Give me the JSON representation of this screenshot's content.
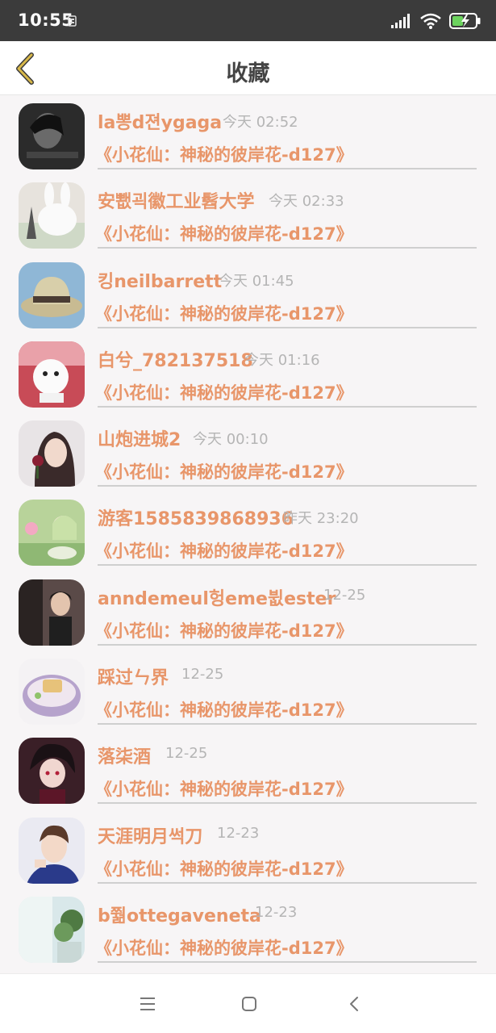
{
  "status_bar": {
    "time": "10:55",
    "icons": [
      "notification-icon",
      "signal-icon",
      "wifi-icon",
      "battery-charging-icon"
    ]
  },
  "header": {
    "title": "收藏",
    "back_icon": "chevron-left-icon"
  },
  "favorites": [
    {
      "name": "la뽕d젼ygaga",
      "time": "今天 02:52",
      "book": "《小花仙：神秘的彼岸花-d127》"
    },
    {
      "name": "安뾊괵徽工业髫大学",
      "time": "今天 02:33",
      "book": "《小花仙：神秘的彼岸花-d127》"
    },
    {
      "name": "킹neilbarrett",
      "time": "今天 01:45",
      "book": "《小花仙：神秘的彼岸花-d127》"
    },
    {
      "name": "白兮_782137518",
      "time": "今天 01:16",
      "book": "《小花仙：神秘的彼岸花-d127》"
    },
    {
      "name": "山炮进城2",
      "time": "今天 00:10",
      "book": "《小花仙：神秘的彼岸花-d127》"
    },
    {
      "name": "游客1585839868936",
      "time": "昨天 23:20",
      "book": "《小花仙：神秘的彼岸花-d127》"
    },
    {
      "name": "anndemeul헝eme뷦ester",
      "time": "12-25",
      "book": "《小花仙：神秘的彼岸花-d127》"
    },
    {
      "name": "踩过ㄣ界",
      "time": "12-25",
      "book": "《小花仙：神秘的彼岸花-d127》"
    },
    {
      "name": "落柒酒",
      "time": "12-25",
      "book": "《小花仙：神秘的彼岸花-d127》"
    },
    {
      "name": "天涯明月썩刀",
      "time": "12-23",
      "book": "《小花仙：神秘的彼岸花-d127》"
    },
    {
      "name": "b쭮ottegaveneta",
      "time": "12-23",
      "book": "《小花仙：神秘的彼岸花-d127》"
    }
  ],
  "navbar": {
    "menu_icon": "menu-icon",
    "home_icon": "home-square-icon",
    "back_icon": "back-arrow-icon"
  },
  "colors": {
    "accent": "#e8966a",
    "time_gray": "#b5b5b5",
    "status_bar": "#3b3b3b",
    "battery": "#6cd35e",
    "back_arrow": "#d8b84a"
  }
}
